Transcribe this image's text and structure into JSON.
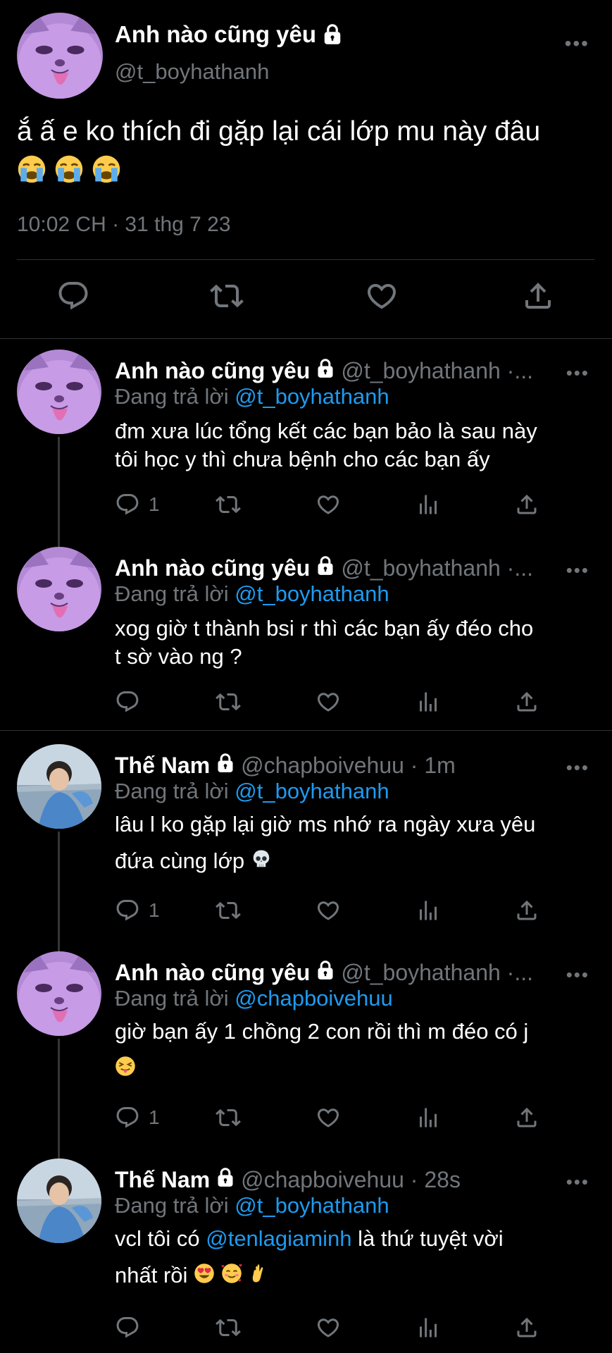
{
  "main_tweet": {
    "name": "Anh nào cũng yêu",
    "handle": "@t_boyhathanh",
    "text": "ắ ấ e ko thích đi gặp lại cái lớp mu này đâu",
    "timestamp": "10:02 CH · 31 thg 7 23",
    "more": "•••"
  },
  "replies": [
    {
      "name": "Anh nào cũng yêu",
      "handle": "@t_boyhathanh ·...",
      "replying_label": "Đang trả lời",
      "replying_to": "@t_boyhathanh",
      "text_lines": [
        "đm xưa lúc tổng kết các bạn bảo là sau này",
        "tôi học y thì chưa bệnh cho các bạn ấy"
      ],
      "reply_count": "1"
    },
    {
      "name": "Anh nào cũng yêu",
      "handle": "@t_boyhathanh ·...",
      "replying_label": "Đang trả lời",
      "replying_to": "@t_boyhathanh",
      "text_lines": [
        "xog giờ t thành bsi r thì các bạn ấy đéo cho",
        "t sờ vào ng ?"
      ],
      "reply_count": ""
    },
    {
      "name": "Thế Nam",
      "handle": "@chapboivehuu · 1m",
      "replying_label": "Đang trả lời",
      "replying_to": "@t_boyhathanh",
      "text_lines": [
        "lâu l ko gặp lại giờ ms nhớ ra ngày xưa yêu",
        "đứa cùng lớp"
      ],
      "reply_count": "1"
    },
    {
      "name": "Anh nào cũng yêu",
      "handle": "@t_boyhathanh ·...",
      "replying_label": "Đang trả lời",
      "replying_to": "@chapboivehuu",
      "text_lines": [
        "giờ bạn ấy 1 chồng 2 con rồi thì m đéo có j"
      ],
      "reply_count": "1"
    },
    {
      "name": "Thế Nam",
      "handle": "@chapboivehuu · 28s",
      "replying_label": "Đang trả lời",
      "replying_to": "@t_boyhathanh",
      "text_prefix": "vcl tôi có",
      "mention": "@tenlagiaminh",
      "text_suffix": "là thứ tuyệt vời",
      "text_line2": "nhất rồi",
      "reply_count": ""
    }
  ],
  "icons": {
    "reply": "reply-icon",
    "retweet": "retweet-icon",
    "like": "heart-icon",
    "views": "views-icon",
    "share": "share-icon",
    "lock": "lock-icon",
    "more": "more-icon"
  },
  "colors": {
    "background": "#000000",
    "text": "#ffffff",
    "muted": "#71767b",
    "link": "#1d9bf0",
    "divider": "#2f3336"
  }
}
